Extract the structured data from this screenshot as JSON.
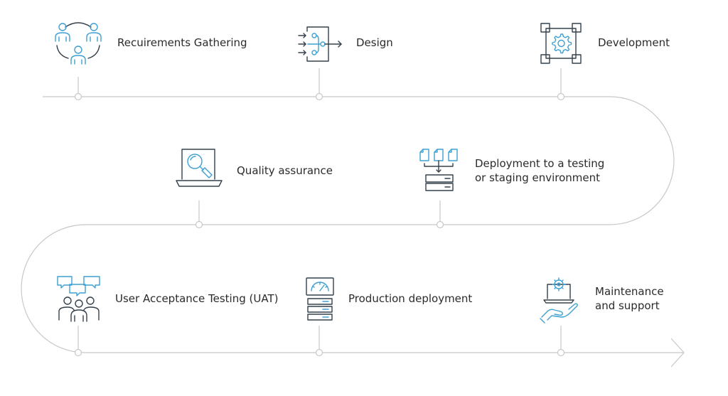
{
  "steps": [
    {
      "label": "Recuirements Gathering",
      "icon": "people-team-icon"
    },
    {
      "label": "Design",
      "icon": "design-flow-icon"
    },
    {
      "label": "Development",
      "icon": "gear-frame-icon"
    },
    {
      "label": "Quality assurance",
      "icon": "laptop-search-icon"
    },
    {
      "label_line1": "Deployment to a testing",
      "label_line2": "or staging environment",
      "icon": "documents-server-icon"
    },
    {
      "label": "User Acceptance Testing (UAT)",
      "icon": "users-chat-icon"
    },
    {
      "label": "Production deployment",
      "icon": "server-gauge-icon"
    },
    {
      "label_line1": "Maintenance",
      "label_line2": "and support",
      "icon": "hand-laptop-gear-icon"
    }
  ],
  "colors": {
    "line": "#c8c8c8",
    "icon_dark": "#33404b",
    "icon_accent": "#3ea0d2",
    "text": "#2b2b2b"
  }
}
